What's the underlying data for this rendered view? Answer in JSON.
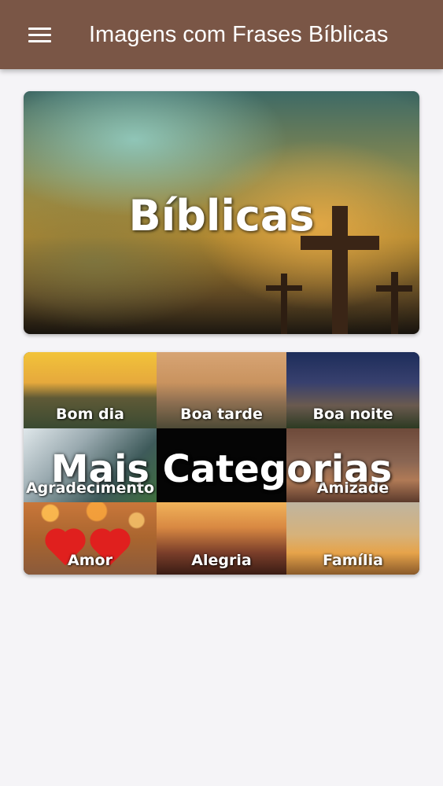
{
  "app_bar": {
    "title": "Imagens com Frases Bíblicas",
    "menu_icon": "hamburger-menu-icon",
    "background_color": "#7a5646"
  },
  "cards": {
    "biblicas": {
      "label": "Bíblicas"
    },
    "more_categories": {
      "label": "Mais Categorias",
      "tiles": [
        {
          "label": "Bom dia"
        },
        {
          "label": "Boa tarde"
        },
        {
          "label": "Boa noite"
        },
        {
          "label": "Agradecimento"
        },
        {
          "label": ""
        },
        {
          "label": "Amizade"
        },
        {
          "label": "Amor"
        },
        {
          "label": "Alegria"
        },
        {
          "label": "Família"
        }
      ]
    }
  }
}
